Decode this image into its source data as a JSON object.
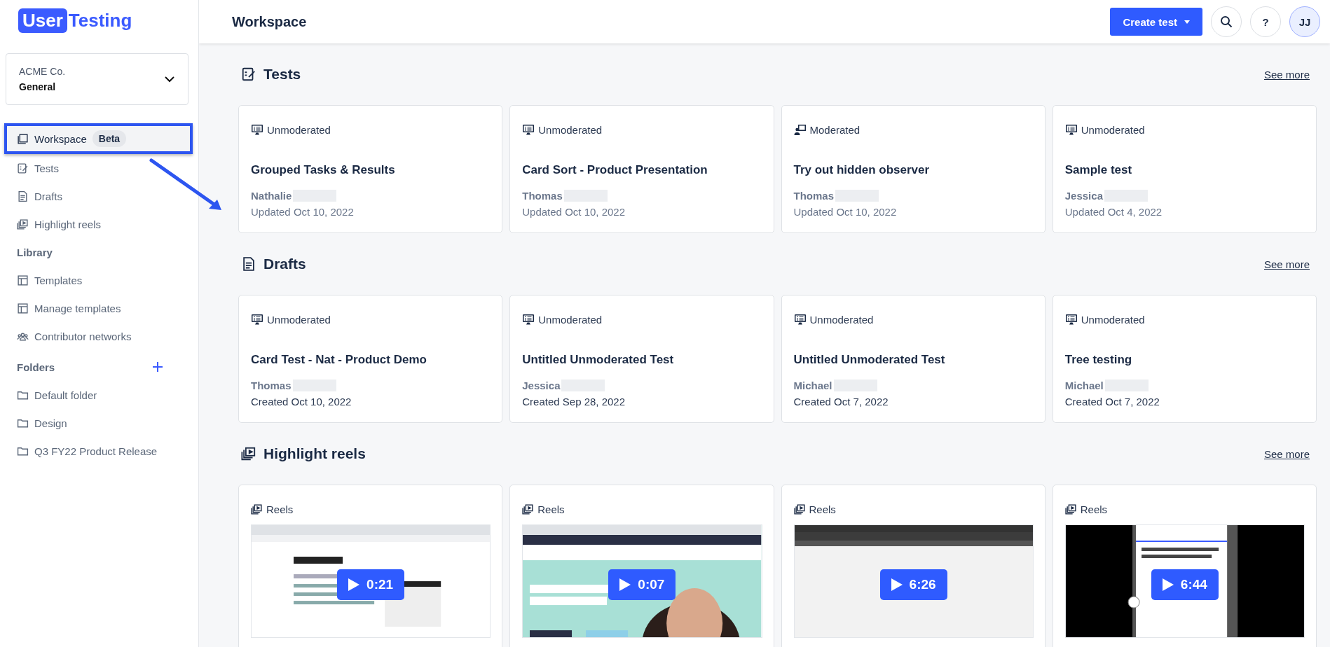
{
  "brand": {
    "logo_box": "User",
    "logo_text": "Testing"
  },
  "account": {
    "company": "ACME Co.",
    "workspace": "General"
  },
  "nav": [
    {
      "label": "Workspace",
      "badge": "Beta",
      "selected": true,
      "highlighted": true
    },
    {
      "label": "Tests",
      "selected": false,
      "highlighted": false
    },
    {
      "label": "Drafts",
      "selected": false,
      "highlighted": false
    },
    {
      "label": "Highlight reels",
      "selected": false,
      "highlighted": false
    }
  ],
  "library": {
    "title": "Library",
    "items": [
      {
        "label": "Templates"
      },
      {
        "label": "Manage templates"
      },
      {
        "label": "Contributor networks"
      }
    ]
  },
  "folders": {
    "title": "Folders",
    "items": [
      {
        "label": "Default folder"
      },
      {
        "label": "Design"
      },
      {
        "label": "Q3 FY22 Product Release"
      }
    ]
  },
  "header": {
    "title": "Workspace",
    "create_button": "Create test",
    "help": "?",
    "avatar": "JJ"
  },
  "sections": [
    {
      "title": "Tests",
      "see_more": "See more",
      "cards": [
        {
          "kind": "test",
          "moderated": false,
          "type_label": "Unmoderated",
          "title": "Grouped Tasks & Results",
          "author": "Nathalie",
          "date": "Updated Oct 10, 2022"
        },
        {
          "kind": "test",
          "moderated": false,
          "type_label": "Unmoderated",
          "title": "Card Sort - Product Presentation",
          "author": "Thomas",
          "date": "Updated Oct 10, 2022"
        },
        {
          "kind": "test",
          "moderated": true,
          "type_label": "Moderated",
          "title": "Try out hidden observer",
          "author": "Thomas",
          "date": "Updated Oct 10, 2022"
        },
        {
          "kind": "test",
          "moderated": false,
          "type_label": "Unmoderated",
          "title": "Sample test",
          "author": "Jessica",
          "date": "Updated Oct 4, 2022"
        }
      ]
    },
    {
      "title": "Drafts",
      "see_more": "See more",
      "cards": [
        {
          "kind": "test",
          "moderated": false,
          "type_label": "Unmoderated",
          "title": "Card Test - Nat - Product Demo",
          "author": "Thomas",
          "date": "Created Oct 10, 2022"
        },
        {
          "kind": "test",
          "moderated": false,
          "type_label": "Unmoderated",
          "title": "Untitled Unmoderated Test",
          "author": "Jessica",
          "date": "Created Sep 28, 2022"
        },
        {
          "kind": "test",
          "moderated": false,
          "type_label": "Unmoderated",
          "title": "Untitled Unmoderated Test",
          "author": "Michael",
          "date": "Created Oct 7, 2022"
        },
        {
          "kind": "test",
          "moderated": false,
          "type_label": "Unmoderated",
          "title": "Tree testing",
          "author": "Michael",
          "date": "Created Oct 7, 2022"
        }
      ]
    },
    {
      "title": "Highlight reels",
      "see_more": "See more",
      "cards": [
        {
          "kind": "reel",
          "type_label": "Reels",
          "duration": "0:21"
        },
        {
          "kind": "reel",
          "type_label": "Reels",
          "duration": "0:07"
        },
        {
          "kind": "reel",
          "type_label": "Reels",
          "duration": "6:26"
        },
        {
          "kind": "reel",
          "type_label": "Reels",
          "duration": "6:44"
        }
      ]
    }
  ]
}
